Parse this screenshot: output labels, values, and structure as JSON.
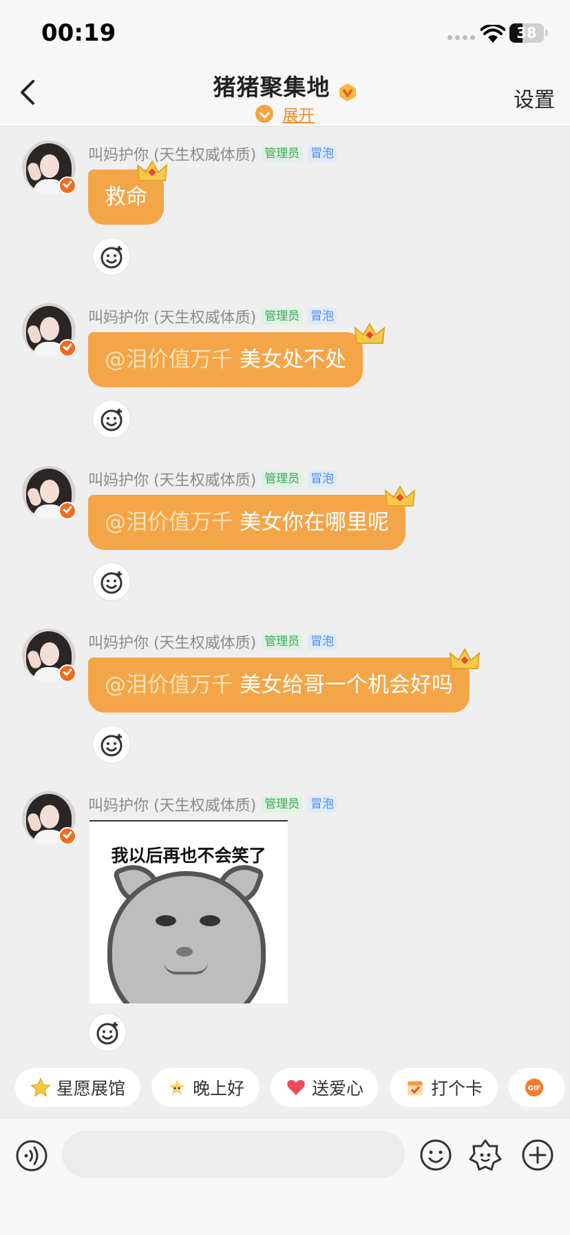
{
  "status_bar": {
    "time": "00:19",
    "battery": "38",
    "battery_level": 0.38
  },
  "header": {
    "title": "猪猪聚集地",
    "expand_label": "展开",
    "settings_label": "设置"
  },
  "messages": [
    {
      "sender": "叫妈护你 (天生权威体质)",
      "tag_admin": "管理员",
      "tag_bubble": "冒泡",
      "mention": "",
      "text": "救命"
    },
    {
      "sender": "叫妈护你 (天生权威体质)",
      "tag_admin": "管理员",
      "tag_bubble": "冒泡",
      "mention": "@泪价值万千",
      "text": "美女处不处"
    },
    {
      "sender": "叫妈护你 (天生权威体质)",
      "tag_admin": "管理员",
      "tag_bubble": "冒泡",
      "mention": "@泪价值万千",
      "text": "美女你在哪里呢"
    },
    {
      "sender": "叫妈护你 (天生权威体质)",
      "tag_admin": "管理员",
      "tag_bubble": "冒泡",
      "mention": "@泪价值万千",
      "text": "美女给哥一个机会好吗"
    },
    {
      "sender": "叫妈护你 (天生权威体质)",
      "tag_admin": "管理员",
      "tag_bubble": "冒泡",
      "sticker_caption": "我以后再也不会笑了"
    }
  ],
  "quick_actions": [
    {
      "label": "星愿展馆",
      "icon": "star-icon"
    },
    {
      "label": "晚上好",
      "icon": "moon-star-icon"
    },
    {
      "label": "送爱心",
      "icon": "heart-icon"
    },
    {
      "label": "打个卡",
      "icon": "checkin-icon"
    },
    {
      "label": "",
      "icon": "gif-icon"
    }
  ],
  "input_bar": {
    "placeholder": ""
  },
  "colors": {
    "bubble": "#f4a548",
    "accent": "#f08c2e",
    "background": "#efefef"
  }
}
